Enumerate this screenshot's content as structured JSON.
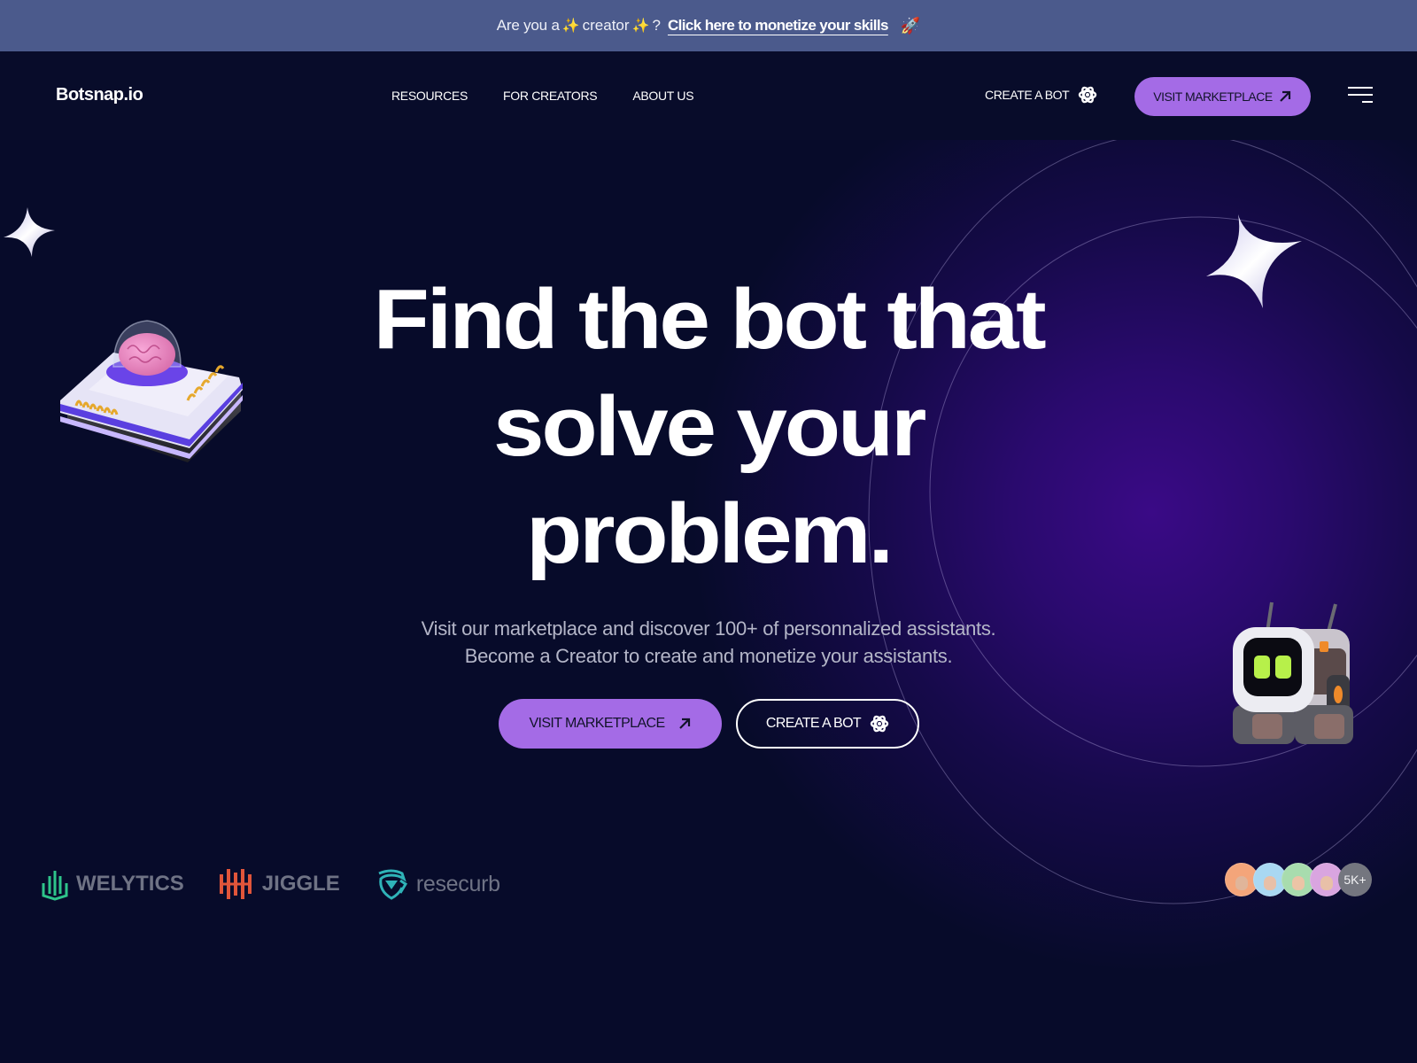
{
  "announcement": {
    "lead": "Are you a",
    "spark_glyph": "✨",
    "middle": "creator",
    "question": "?",
    "cta": "Click here to monetize your skills",
    "rocket_glyph": "🚀"
  },
  "nav": {
    "logo": "Botsnap.io",
    "links": [
      {
        "label": "RESOURCES"
      },
      {
        "label": "FOR CREATORS"
      },
      {
        "label": "ABOUT US"
      }
    ],
    "create_bot": "CREATE A BOT",
    "visit_marketplace": "VISIT MARKETPLACE",
    "menu_icon": "hamburger-icon"
  },
  "hero": {
    "headline_lines": [
      "Find the bot that",
      "solve your",
      "problem."
    ],
    "subtitle_lines": [
      "Visit our marketplace and discover 100+ of personnalized assistants.",
      "Become a Creator to create and monetize your assistants."
    ],
    "primary_cta": "VISIT MARKETPLACE",
    "secondary_cta": "CREATE A BOT"
  },
  "partners": [
    {
      "name": "WELYTICS",
      "color": "#2ec48a"
    },
    {
      "name": "JIGGLE",
      "color": "#e0553a"
    },
    {
      "name": "resecurb",
      "color": "#2fb3b8"
    }
  ],
  "community": {
    "avatars": [
      {
        "bg": "#f4a57a"
      },
      {
        "bg": "#a9d8f2"
      },
      {
        "bg": "#a8dcae"
      },
      {
        "bg": "#d9a5e0"
      }
    ],
    "count_label": "5K+"
  },
  "colors": {
    "accent": "#a46be6",
    "background": "#070b2a",
    "announcement_bg": "#4b5a8c",
    "glow": "#3a0a86"
  }
}
